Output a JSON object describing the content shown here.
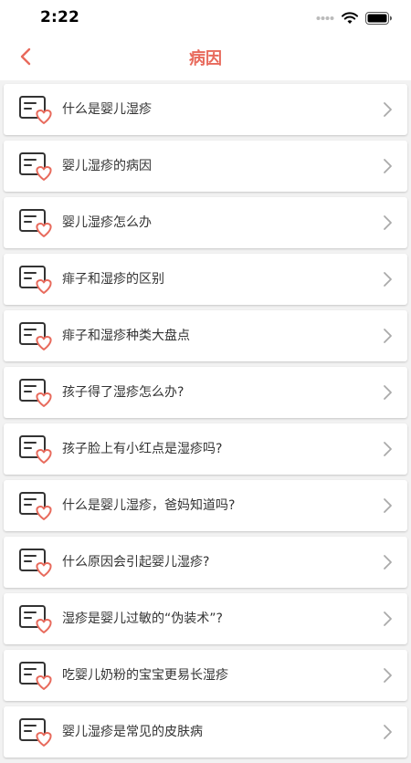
{
  "status": {
    "time": "2:22"
  },
  "header": {
    "title": "病因"
  },
  "items": [
    {
      "label": "什么是婴儿湿疹"
    },
    {
      "label": "婴儿湿疹的病因"
    },
    {
      "label": "婴儿湿疹怎么办"
    },
    {
      "label": "痱子和湿疹的区别"
    },
    {
      "label": "痱子和湿疹种类大盘点"
    },
    {
      "label": "孩子得了湿疹怎么办?"
    },
    {
      "label": "孩子脸上有小红点是湿疹吗?"
    },
    {
      "label": "什么是婴儿湿疹，爸妈知道吗?"
    },
    {
      "label": "什么原因会引起婴儿湿疹?"
    },
    {
      "label": "湿疹是婴儿过敏的“伪装术”?"
    },
    {
      "label": "吃婴儿奶粉的宝宝更易长湿疹"
    },
    {
      "label": "婴儿湿疹是常见的皮肤病"
    }
  ],
  "colors": {
    "accent": "#e86a5c",
    "chevron": "#aaaaaa"
  },
  "icons": {
    "back": "chevron-left-icon",
    "item": "document-heart-icon",
    "item_arrow": "chevron-right-icon"
  }
}
